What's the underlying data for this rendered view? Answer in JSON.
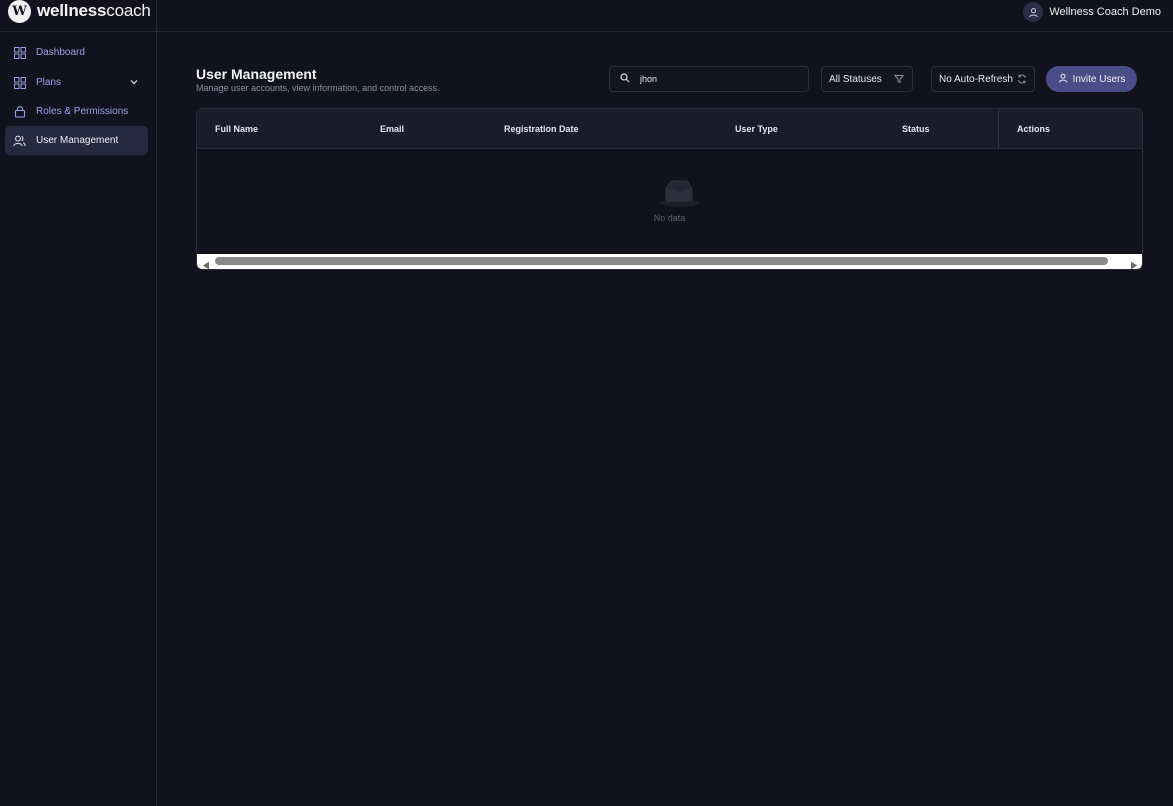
{
  "brand": {
    "name_bold": "wellness",
    "name_light": "coach",
    "logo_letter": "W"
  },
  "header": {
    "user_name": "Wellness Coach Demo",
    "user_icon": "user-icon"
  },
  "sidebar": {
    "items": [
      {
        "label": "Dashboard",
        "icon": "grid-icon"
      },
      {
        "label": "Plans",
        "icon": "grid-icon"
      },
      {
        "label": "Roles & Permissions",
        "icon": "lock-icon"
      },
      {
        "label": "User Management",
        "icon": "users-icon",
        "active": true
      }
    ]
  },
  "main": {
    "title": "User Management",
    "subtitle": "Manage user accounts, view information, and control access.",
    "search": {
      "value": "jhon",
      "placeholder": ""
    },
    "status_filter": "All Statuses",
    "refresh": "No Auto-Refresh",
    "invite_label": "Invite Users"
  },
  "table": {
    "columns": [
      "Full Name",
      "Email",
      "Registration Date",
      "User Type",
      "Status",
      "Actions"
    ],
    "empty_text": "No data"
  },
  "colors": {
    "background": "#11121d",
    "accent": "#4a4e86",
    "nav_text": "#9aa0e6",
    "active_nav": "#272a3e"
  }
}
